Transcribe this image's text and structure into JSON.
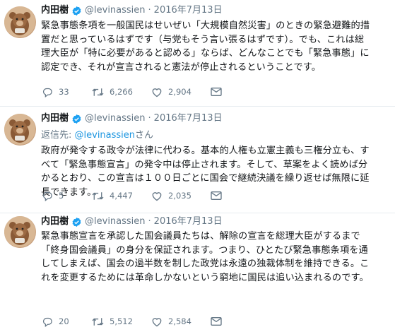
{
  "colors": {
    "link": "#1b95e0",
    "muted": "#657786",
    "text": "#14171a",
    "verified_badge": "#1da1f2",
    "separator": "#e6ecf0"
  },
  "tweets": [
    {
      "author_name": "内田樹",
      "handle": "@levinassien",
      "separator_dot": "·",
      "date": "2016年7月13日",
      "verified_icon": "verified-badge-icon",
      "avatar_icon": "avatar-image",
      "lines": [
        "緊急事態条項を一般国民はせいぜい「大規模自然災害」のときの緊急避難的措",
        "置だと思っているはずです（与党もそう言い張るはずです）。でも、これは総",
        "理大臣が「特に必要があると認める」ならば、どんなことでも「緊急事態」に",
        "認定でき、それが宣言されると憲法が停止されるということです。"
      ],
      "replies": "33",
      "retweets": "6,266",
      "likes": "2,904"
    },
    {
      "author_name": "内田樹",
      "handle": "@levinassien",
      "separator_dot": "·",
      "date": "2016年7月13日",
      "verified_icon": "verified-badge-icon",
      "avatar_icon": "avatar-image",
      "reply_prefix": "返信先: ",
      "reply_mention": "@levinassien",
      "reply_suffix": "さん",
      "lines": [
        "政府が発令する政令が法律に代わる。基本的人権も立憲主義も三権分立も、す",
        "べて「緊急事態宣言」の発令中は停止されます。そして、草案をよく読めば分",
        "かるとおり、この宣言は１００日ごとに国会で継続決議を繰り返せば無限に延",
        "長できます。"
      ],
      "replies": "5",
      "retweets": "4,447",
      "likes": "2,035"
    },
    {
      "author_name": "内田樹",
      "handle": "@levinassien",
      "separator_dot": "·",
      "date": "2016年7月13日",
      "verified_icon": "verified-badge-icon",
      "avatar_icon": "avatar-image",
      "lines": [
        "緊急事態宣言を承認した国会議員たちは、解除の宣言を総理大臣がするまで",
        "「終身国会議員」の身分を保証されます。つまり、ひとたび緊急事態条項を通",
        "してしまえば、国会の過半数を制した政党は永遠の独裁体制を維持できる。こ",
        "れを変更するためには革命しかないという窮地に国民は追い込まれるのです。"
      ],
      "replies": "20",
      "retweets": "5,512",
      "likes": "2,584"
    }
  ]
}
